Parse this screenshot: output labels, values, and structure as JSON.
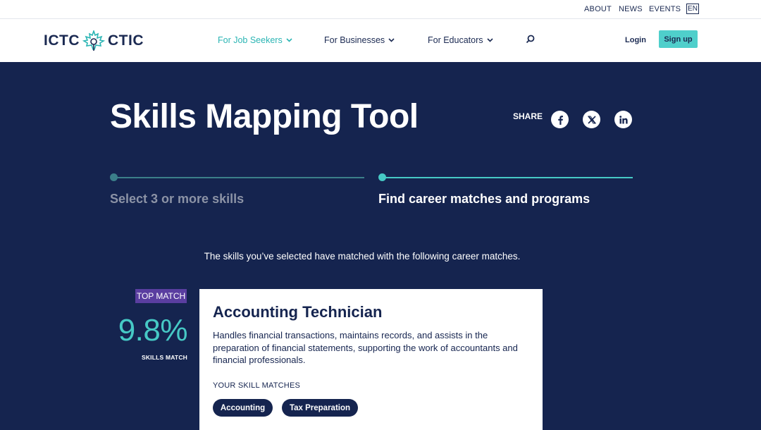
{
  "utility_nav": {
    "about": "ABOUT",
    "news": "NEWS",
    "events": "EVENTS",
    "language": "EN"
  },
  "header": {
    "logo_left": "ICTC",
    "logo_right": "CTIC",
    "nav": [
      {
        "label": "For Job Seekers",
        "active": true
      },
      {
        "label": "For Businesses",
        "active": false
      },
      {
        "label": "For Educators",
        "active": false
      }
    ],
    "login_label": "Login",
    "signup_label": "Sign up"
  },
  "hero": {
    "title": "Skills Mapping Tool",
    "share_label": "SHARE",
    "share_icons": [
      "facebook-icon",
      "x-icon",
      "linkedin-icon"
    ]
  },
  "steps": [
    {
      "label": "Select 3 or more skills",
      "state": "completed"
    },
    {
      "label": "Find career matches and programs",
      "state": "current"
    }
  ],
  "results": {
    "intro": "The skills you’ve selected have matched with the following career matches.",
    "top_match": {
      "badge": "TOP MATCH",
      "percent": "9.8%",
      "percent_label": "SKILLS MATCH",
      "title": "Accounting Technician",
      "description": "Handles financial transactions, maintains records, and assists in the preparation of financial statements, supporting the work of accountants and financial professionals.",
      "skills_heading": "YOUR SKILL MATCHES",
      "skills": [
        "Accounting",
        "Tax Preparation"
      ]
    }
  },
  "colors": {
    "navy": "#15244f",
    "teal": "#46c9c5",
    "purple": "#5a3ea0",
    "signup": "#4fcfcb"
  }
}
